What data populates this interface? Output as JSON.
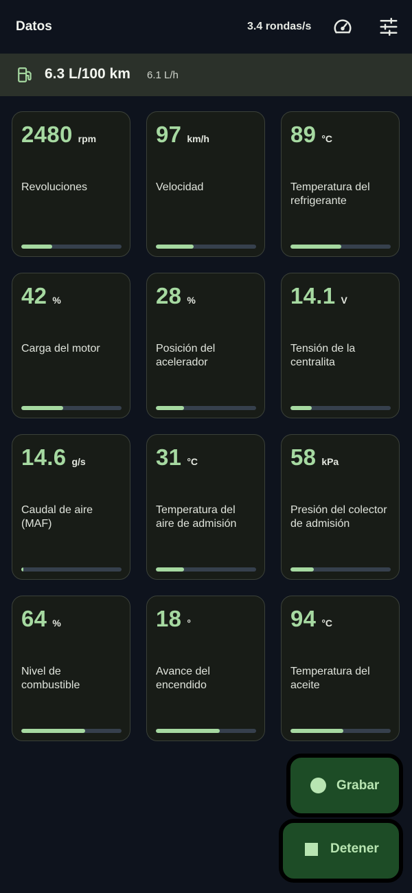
{
  "header": {
    "title": "Datos",
    "rate": "3.4 rondas/s",
    "gauge_icon": "gauge-icon",
    "settings_icon": "tune-icon"
  },
  "fuel": {
    "icon": "fuel-pump-icon",
    "consumption": "6.3 L/100 km",
    "flow": "6.1 L/h"
  },
  "cards": [
    {
      "value": "2480",
      "unit": "rpm",
      "label": "Revoluciones",
      "fill": 0.31
    },
    {
      "value": "97",
      "unit": "km/h",
      "label": "Velocidad",
      "fill": 0.38
    },
    {
      "value": "89",
      "unit": "°C",
      "label": "Temperatura del refrigerante",
      "fill": 0.51
    },
    {
      "value": "42",
      "unit": "%",
      "label": "Carga del motor",
      "fill": 0.42
    },
    {
      "value": "28",
      "unit": "%",
      "label": "Posición del acelerador",
      "fill": 0.28
    },
    {
      "value": "14.1",
      "unit": "V",
      "label": "Tensión de la centralita",
      "fill": 0.21
    },
    {
      "value": "14.6",
      "unit": "g/s",
      "label": "Caudal de aire (MAF)",
      "fill": 0.02
    },
    {
      "value": "31",
      "unit": "°C",
      "label": "Temperatura del aire de admisión",
      "fill": 0.28
    },
    {
      "value": "58",
      "unit": "kPa",
      "label": "Presión del colector de admisión",
      "fill": 0.23
    },
    {
      "value": "64",
      "unit": "%",
      "label": "Nivel de combustible",
      "fill": 0.64
    },
    {
      "value": "18",
      "unit": "°",
      "label": "Avance del encendido",
      "fill": 0.64
    },
    {
      "value": "94",
      "unit": "°C",
      "label": "Temperatura del aceite",
      "fill": 0.53
    }
  ],
  "actions": {
    "record_label": "Grabar",
    "stop_label": "Detener"
  },
  "colors": {
    "accent": "#a6d9a1",
    "background": "#0e131d",
    "fab": "#1d4c26"
  }
}
